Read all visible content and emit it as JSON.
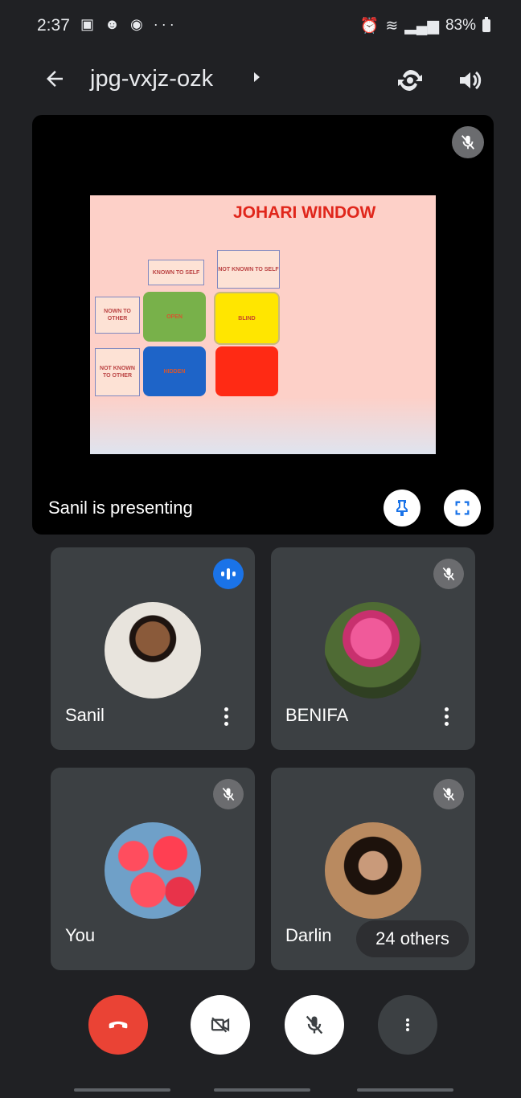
{
  "status_bar": {
    "time": "2:37",
    "left_icons": [
      "image-icon",
      "people-icon",
      "messenger-icon"
    ],
    "overflow": "···",
    "right_text": "83%"
  },
  "app_bar": {
    "meeting_code": "jpg-vxjz-ozk"
  },
  "presentation": {
    "presenter_text": "Sanil is presenting",
    "slide": {
      "title": "JOHARI WINDOW",
      "col_labels": [
        "KNOWN TO SELF",
        "NOT KNOWN TO SELF"
      ],
      "row_labels": [
        "NOWN TO OTHER",
        "NOT KNOWN TO OTHER"
      ],
      "quadrants": [
        "OPEN",
        "BLIND",
        "HIDDEN",
        ""
      ]
    }
  },
  "participants": [
    {
      "name": "Sanil",
      "speaking": true
    },
    {
      "name": "BENIFA",
      "muted": true
    },
    {
      "name": "You",
      "muted": true
    },
    {
      "name": "Darlin",
      "muted": true
    }
  ],
  "others_chip": "24 others",
  "colors": {
    "background": "#202124",
    "tile": "#3c4043",
    "end_call": "#ea4335",
    "speaking": "#1a73e8"
  }
}
